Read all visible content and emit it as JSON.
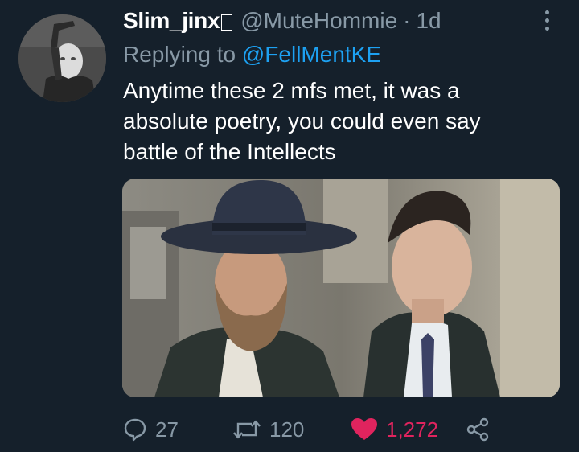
{
  "tweet": {
    "author": {
      "display_name": "Slim_jinx",
      "handle": "@MuteHommie",
      "separator": "·",
      "time": "1d"
    },
    "reply": {
      "prefix": "Replying to",
      "target": "@FellMentKE"
    },
    "text_lines": [
      "Anytime these 2 mfs met, it was a",
      "absolute poetry, you could even say",
      "battle of the Intellects"
    ],
    "stats": {
      "replies": "27",
      "retweets": "120",
      "likes": "1,272"
    },
    "liked": true
  },
  "icons": {
    "reply": "reply-icon",
    "retweet": "retweet-icon",
    "like": "heart-icon",
    "share": "share-icon",
    "more": "more-options-icon"
  },
  "colors": {
    "background": "#15202b",
    "secondary_text": "#8899a6",
    "link": "#1da1f2",
    "like": "#e0245e"
  }
}
